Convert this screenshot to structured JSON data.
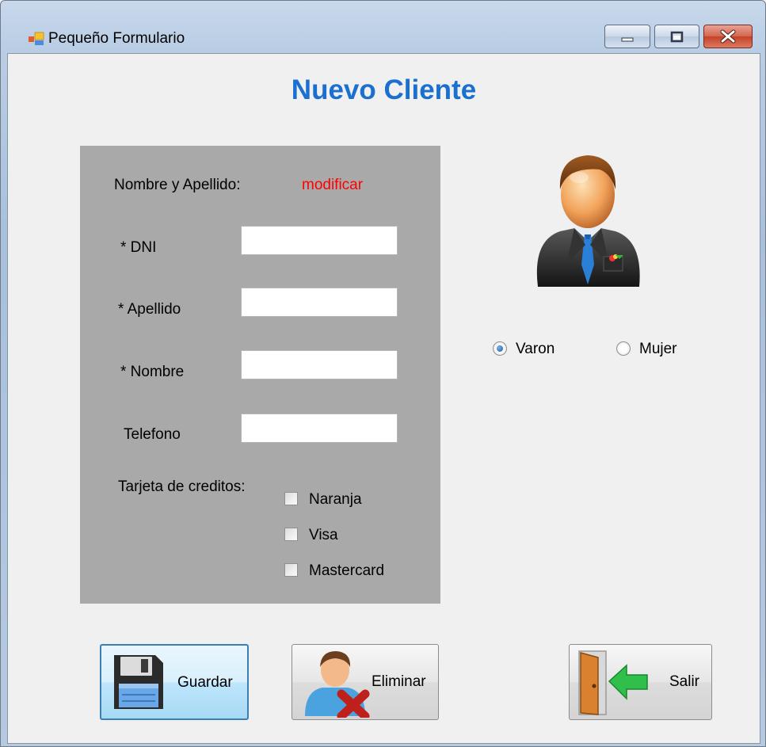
{
  "window": {
    "title": "Pequeño Formulario"
  },
  "form": {
    "heading": "Nuevo Cliente",
    "name_label": "Nombre y Apellido:",
    "name_value": "modificar",
    "fields": [
      {
        "label": "* DNI",
        "value": ""
      },
      {
        "label": "* Apellido",
        "value": ""
      },
      {
        "label": "* Nombre",
        "value": ""
      },
      {
        "label": "Telefono",
        "value": ""
      }
    ],
    "credit_cards_label": "Tarjeta de creditos:",
    "credit_cards": [
      {
        "label": "Naranja",
        "checked": false
      },
      {
        "label": "Visa",
        "checked": false
      },
      {
        "label": "Mastercard",
        "checked": false
      }
    ],
    "gender": [
      {
        "label": "Varon",
        "selected": true
      },
      {
        "label": "Mujer",
        "selected": false
      }
    ]
  },
  "buttons": {
    "save": "Guardar",
    "delete": "Eliminar",
    "exit": "Salir"
  },
  "icons": {
    "app": "form-app-icon",
    "avatar": "businessman-avatar-icon",
    "save": "floppy-disk-icon",
    "delete": "user-delete-icon",
    "exit": "exit-door-icon"
  },
  "colors": {
    "heading": "#1a6fcf",
    "name_value": "#ff0000",
    "panel": "#a9a9a9"
  }
}
